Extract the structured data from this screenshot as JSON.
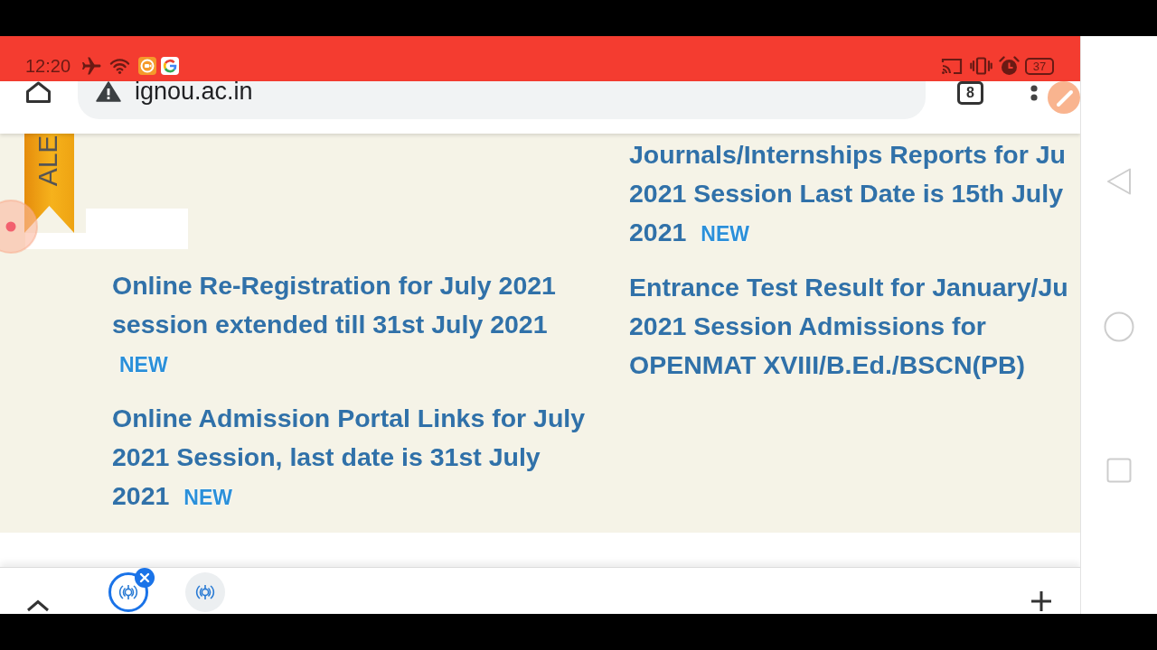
{
  "status_bar": {
    "time": "12:20",
    "battery": "37"
  },
  "toolbar": {
    "url": "ignou.ac.in",
    "tab_count": "8"
  },
  "page": {
    "banner": {
      "label": "ALE"
    },
    "left_notices": [
      {
        "lines": [
          "Online Re-Registration for July 2021",
          "session extended till 31st July 2021"
        ],
        "new_label": "NEW"
      },
      {
        "lines": [
          "Online Admission Portal Links for July",
          "2021 Session, last date is 31st July",
          "2021"
        ],
        "new_label": "NEW"
      }
    ],
    "right_notices": [
      {
        "lines": [
          "Journals/Internships Reports for Ju",
          "2021 Session Last Date is 15th July",
          "2021"
        ],
        "new_label": "NEW"
      },
      {
        "lines": [
          "Entrance Test Result for January/Ju",
          "2021 Session Admissions for",
          "OPENMAT XVIII/B.Ed./BSCN(PB)"
        ]
      }
    ]
  },
  "tab_strip": {
    "tabs": [
      {
        "selected": true
      },
      {
        "selected": false
      }
    ]
  }
}
